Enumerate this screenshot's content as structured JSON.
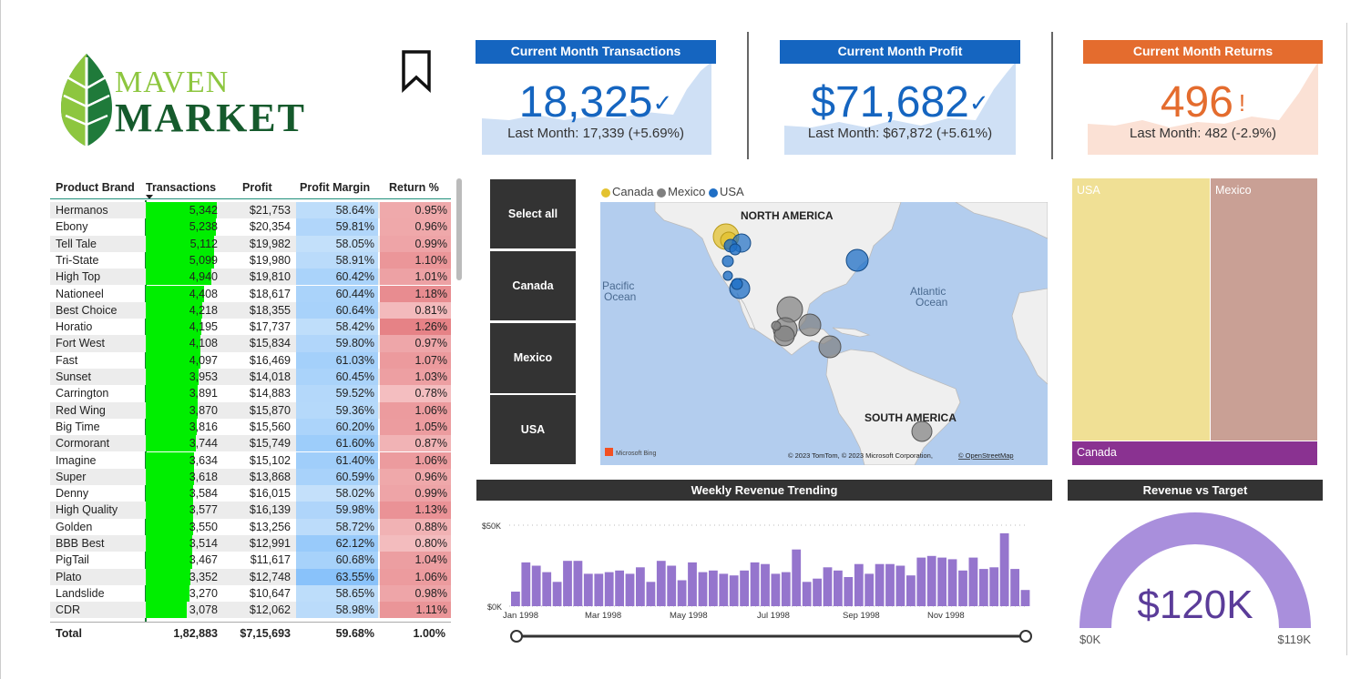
{
  "logo": {
    "line1": "MAVEN",
    "line2": "MARKET"
  },
  "kpis": [
    {
      "title": "Current Month Transactions",
      "value": "18,325",
      "indicator": "✓",
      "sub": "Last Month: 17,339 (+5.69%)",
      "header_color": "#1565c0",
      "value_color": "#1565c0",
      "spark_color": "#cfe0f5"
    },
    {
      "title": "Current Month Profit",
      "value": "$71,682",
      "indicator": "✓",
      "sub": "Last Month: $67,872 (+5.61%)",
      "header_color": "#1565c0",
      "value_color": "#1565c0",
      "spark_color": "#cfe0f5"
    },
    {
      "title": "Current Month Returns",
      "value": "496",
      "indicator": "!",
      "sub": "Last Month: 482 (-2.9%)",
      "header_color": "#e46c2e",
      "value_color": "#e46c2e",
      "spark_color": "#fbe1d5"
    }
  ],
  "table": {
    "headers": [
      "Product Brand",
      "Transactions",
      "Profit",
      "Profit Margin",
      "Return %"
    ],
    "rows": [
      {
        "brand": "Hermanos",
        "transactions": "5,342",
        "tx": 5342,
        "profit": "$21,753",
        "margin": "58.64%",
        "ret": "0.95%"
      },
      {
        "brand": "Ebony",
        "transactions": "5,238",
        "tx": 5238,
        "profit": "$20,354",
        "margin": "59.81%",
        "ret": "0.96%"
      },
      {
        "brand": "Tell Tale",
        "transactions": "5,112",
        "tx": 5112,
        "profit": "$19,982",
        "margin": "58.05%",
        "ret": "0.99%"
      },
      {
        "brand": "Tri-State",
        "transactions": "5,099",
        "tx": 5099,
        "profit": "$19,980",
        "margin": "58.91%",
        "ret": "1.10%"
      },
      {
        "brand": "High Top",
        "transactions": "4,940",
        "tx": 4940,
        "profit": "$19,810",
        "margin": "60.42%",
        "ret": "1.01%"
      },
      {
        "brand": "Nationeel",
        "transactions": "4,408",
        "tx": 4408,
        "profit": "$18,617",
        "margin": "60.44%",
        "ret": "1.18%"
      },
      {
        "brand": "Best Choice",
        "transactions": "4,218",
        "tx": 4218,
        "profit": "$18,355",
        "margin": "60.64%",
        "ret": "0.81%"
      },
      {
        "brand": "Horatio",
        "transactions": "4,195",
        "tx": 4195,
        "profit": "$17,737",
        "margin": "58.42%",
        "ret": "1.26%"
      },
      {
        "brand": "Fort West",
        "transactions": "4,108",
        "tx": 4108,
        "profit": "$15,834",
        "margin": "59.80%",
        "ret": "0.97%"
      },
      {
        "brand": "Fast",
        "transactions": "4,097",
        "tx": 4097,
        "profit": "$16,469",
        "margin": "61.03%",
        "ret": "1.07%"
      },
      {
        "brand": "Sunset",
        "transactions": "3,953",
        "tx": 3953,
        "profit": "$14,018",
        "margin": "60.45%",
        "ret": "1.03%"
      },
      {
        "brand": "Carrington",
        "transactions": "3,891",
        "tx": 3891,
        "profit": "$14,883",
        "margin": "59.52%",
        "ret": "0.78%"
      },
      {
        "brand": "Red Wing",
        "transactions": "3,870",
        "tx": 3870,
        "profit": "$15,870",
        "margin": "59.36%",
        "ret": "1.06%"
      },
      {
        "brand": "Big Time",
        "transactions": "3,816",
        "tx": 3816,
        "profit": "$15,560",
        "margin": "60.20%",
        "ret": "1.05%"
      },
      {
        "brand": "Cormorant",
        "transactions": "3,744",
        "tx": 3744,
        "profit": "$15,749",
        "margin": "61.60%",
        "ret": "0.87%"
      },
      {
        "brand": "Imagine",
        "transactions": "3,634",
        "tx": 3634,
        "profit": "$15,102",
        "margin": "61.40%",
        "ret": "1.06%"
      },
      {
        "brand": "Super",
        "transactions": "3,618",
        "tx": 3618,
        "profit": "$13,868",
        "margin": "60.59%",
        "ret": "0.96%"
      },
      {
        "brand": "Denny",
        "transactions": "3,584",
        "tx": 3584,
        "profit": "$16,015",
        "margin": "58.02%",
        "ret": "0.99%"
      },
      {
        "brand": "High Quality",
        "transactions": "3,577",
        "tx": 3577,
        "profit": "$16,139",
        "margin": "59.98%",
        "ret": "1.13%"
      },
      {
        "brand": "Golden",
        "transactions": "3,550",
        "tx": 3550,
        "profit": "$13,256",
        "margin": "58.72%",
        "ret": "0.88%"
      },
      {
        "brand": "BBB Best",
        "transactions": "3,514",
        "tx": 3514,
        "profit": "$12,991",
        "margin": "62.12%",
        "ret": "0.80%"
      },
      {
        "brand": "PigTail",
        "transactions": "3,467",
        "tx": 3467,
        "profit": "$11,617",
        "margin": "60.68%",
        "ret": "1.04%"
      },
      {
        "brand": "Plato",
        "transactions": "3,352",
        "tx": 3352,
        "profit": "$12,748",
        "margin": "63.55%",
        "ret": "1.06%"
      },
      {
        "brand": "Landslide",
        "transactions": "3,270",
        "tx": 3270,
        "profit": "$10,647",
        "margin": "58.65%",
        "ret": "0.98%"
      },
      {
        "brand": "CDR",
        "transactions": "3,078",
        "tx": 3078,
        "profit": "$12,062",
        "margin": "58.98%",
        "ret": "1.11%"
      }
    ],
    "total": {
      "label": "Total",
      "transactions": "1,82,883",
      "profit": "$7,15,693",
      "margin": "59.68%",
      "ret": "1.00%"
    }
  },
  "slicer": {
    "items": [
      "Select all",
      "Canada",
      "Mexico",
      "USA"
    ]
  },
  "map": {
    "legend": [
      {
        "label": "Canada",
        "color": "#e3c230"
      },
      {
        "label": "Mexico",
        "color": "#7f7f7f"
      },
      {
        "label": "USA",
        "color": "#1f6fc5"
      }
    ],
    "labels": {
      "north_america": "NORTH AMERICA",
      "south_america": "SOUTH AMERICA",
      "pacific": "Pacific\nOcean",
      "pacific1": "Pacific",
      "pacific2": "Ocean",
      "atlantic1": "Atlantic",
      "atlantic2": "Ocean"
    },
    "attribution": "© 2023 TomTom, © 2023 Microsoft Corporation,",
    "attribution_link": "© OpenStreetMap",
    "brand": "Microsoft Bing"
  },
  "treemap": {
    "items": [
      {
        "label": "USA",
        "color": "#f0e095"
      },
      {
        "label": "Mexico",
        "color": "#c9a095"
      },
      {
        "label": "Canada",
        "color": "#8a3291"
      }
    ]
  },
  "weekly": {
    "title": "Weekly Revenue Trending",
    "y_ticks": [
      "$50K",
      "$0K"
    ],
    "x_ticks": [
      "Jan 1998",
      "Mar 1998",
      "May 1998",
      "Jul 1998",
      "Sep 1998",
      "Nov 1998"
    ]
  },
  "gauge": {
    "title": "Revenue vs Target",
    "value": "$120K",
    "min": "$0K",
    "max": "$119K",
    "color": "#a98fdc",
    "value_color": "#5b3c99"
  },
  "chart_data": {
    "type": "bar",
    "title": "Weekly Revenue Trending",
    "ylim": [
      0,
      50000
    ],
    "x_labels": [
      "Jan 1998",
      "Mar 1998",
      "May 1998",
      "Jul 1998",
      "Sep 1998",
      "Nov 1998"
    ],
    "values": [
      9000,
      27000,
      25000,
      21000,
      15000,
      28000,
      28000,
      20000,
      20000,
      21000,
      22000,
      20000,
      24000,
      15000,
      28000,
      25000,
      16000,
      27000,
      21000,
      22000,
      20000,
      19000,
      22000,
      27000,
      26000,
      20000,
      21000,
      35000,
      15000,
      17000,
      24000,
      22000,
      18000,
      26000,
      20000,
      26000,
      26000,
      25000,
      19000,
      30000,
      31000,
      30000,
      29000,
      22000,
      30000,
      23000,
      24000,
      45000,
      23000,
      10000
    ]
  }
}
